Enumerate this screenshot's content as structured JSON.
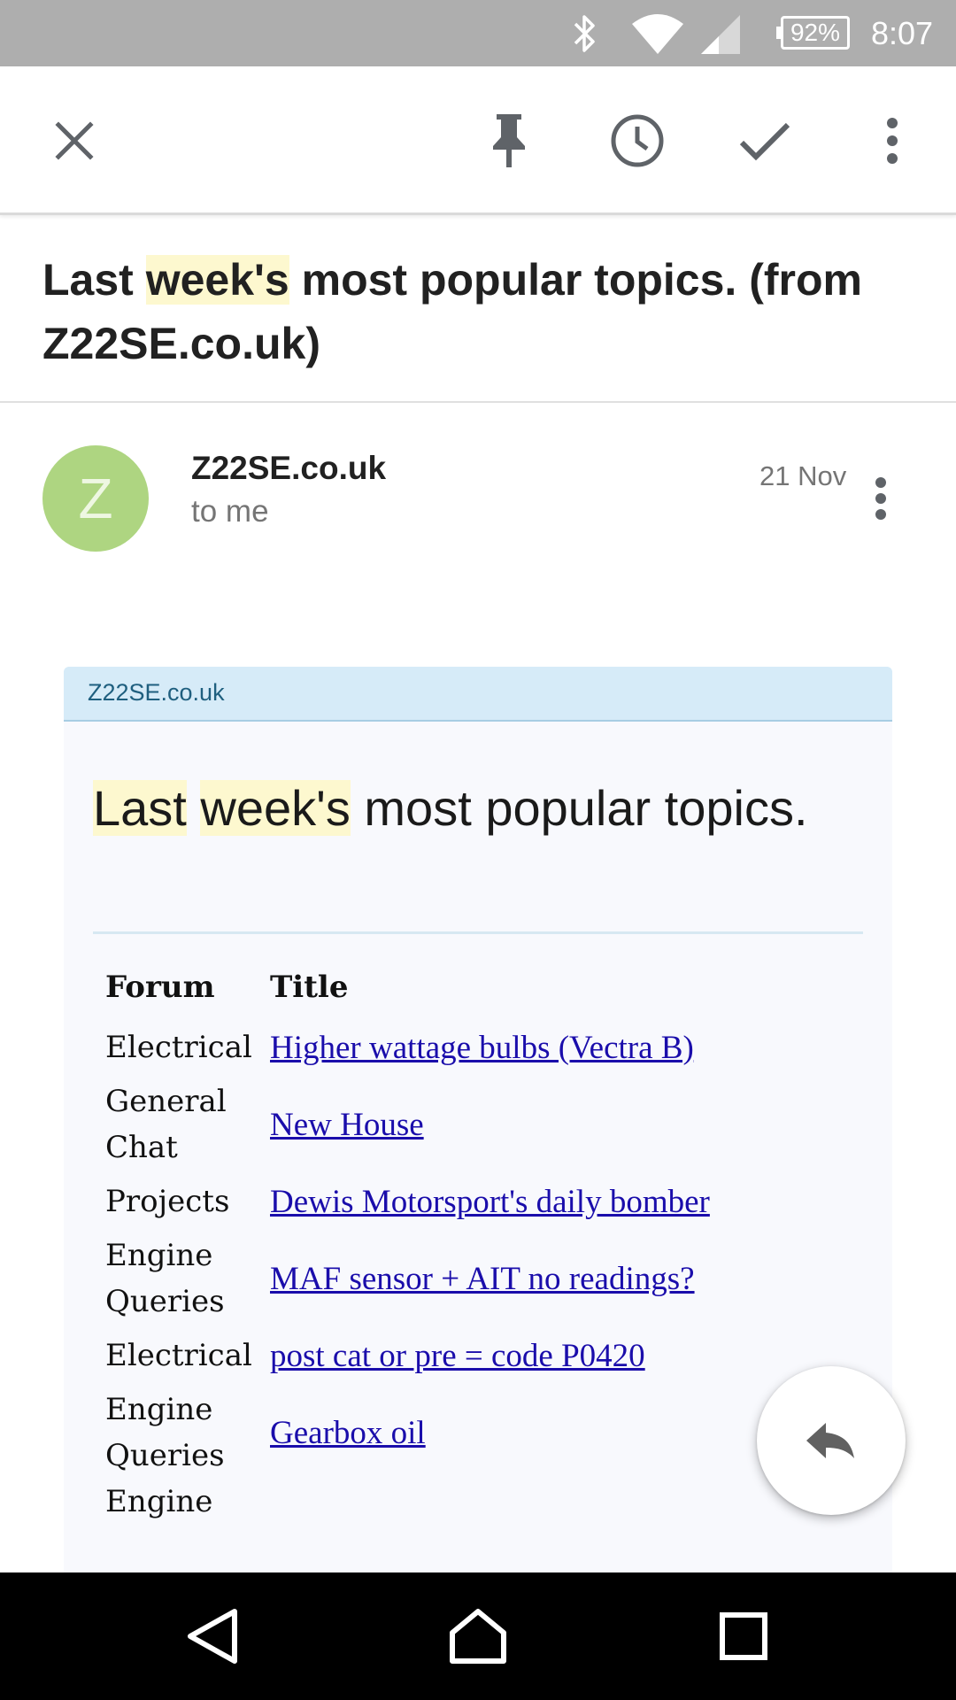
{
  "status_bar": {
    "battery": "92%",
    "time": "8:07",
    "icons": [
      "bluetooth-icon",
      "wifi-icon",
      "signal-icon",
      "battery-icon"
    ]
  },
  "toolbar": {
    "icons": [
      "close-icon",
      "pin-icon",
      "snooze-clock-icon",
      "done-check-icon",
      "more-vert-icon"
    ]
  },
  "email": {
    "subject_parts": [
      {
        "text": "Last ",
        "highlight": false
      },
      {
        "text": "week's",
        "highlight": true
      },
      {
        "text": " most popular topics. (from Z22SE.co.uk)",
        "highlight": false
      }
    ],
    "avatar_letter": "Z",
    "avatar_color": "#aed581",
    "sender": "Z22SE.co.uk",
    "recipient": "to me",
    "date": "21 Nov"
  },
  "message": {
    "header": "Z22SE.co.uk",
    "title_parts": [
      {
        "text": "Last",
        "highlight": true
      },
      {
        "text": " ",
        "highlight": false
      },
      {
        "text": "week's",
        "highlight": true
      },
      {
        "text": " most popular topics.",
        "highlight": false
      }
    ],
    "table": {
      "headers": [
        "Forum",
        "Title"
      ],
      "rows": [
        {
          "forum": "Electrical",
          "title": "Higher wattage bulbs (Vectra B)"
        },
        {
          "forum": "General Chat",
          "title": "New House"
        },
        {
          "forum": "Projects",
          "title": "Dewis Motorsport's daily bomber"
        },
        {
          "forum": "Engine Queries",
          "title": "MAF sensor + AIT no readings?"
        },
        {
          "forum": "Electrical",
          "title": "post cat or pre = code P0420"
        },
        {
          "forum": "Engine Queries",
          "title": "Gearbox oil"
        },
        {
          "forum": "Engine",
          "title": ""
        }
      ]
    }
  },
  "fab": {
    "icon": "reply-icon"
  },
  "nav_bar": {
    "icons": [
      "back-icon",
      "home-icon",
      "recents-icon"
    ]
  },
  "colors": {
    "highlight": "#fdf8cf",
    "link": "#1a0dab",
    "status_bar": "#aeaeae",
    "card_header": "#d6ebf8"
  }
}
